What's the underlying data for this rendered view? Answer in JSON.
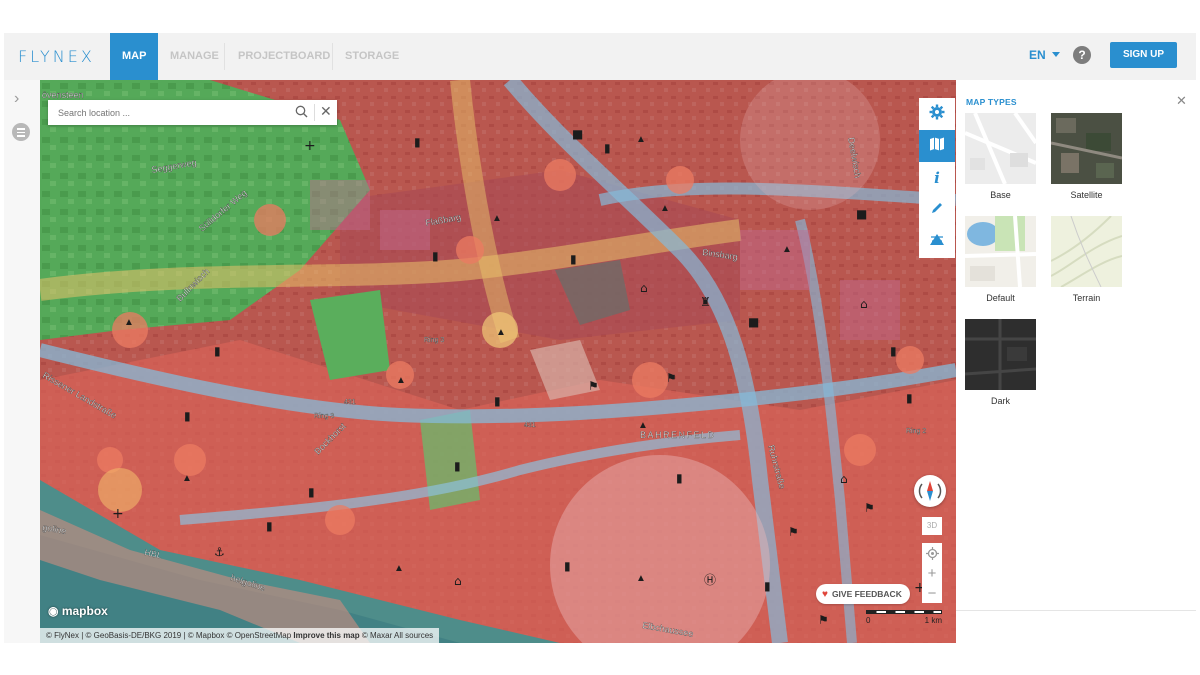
{
  "nav": {
    "logo": "FLYNEX",
    "tabs": [
      {
        "label": "MAP"
      },
      {
        "label": "MANAGE"
      },
      {
        "label": "PROJECTBOARD"
      },
      {
        "label": "STORAGE"
      }
    ],
    "language": "EN",
    "help": "?",
    "signup_label": "SIGN UP"
  },
  "search": {
    "placeholder": "Search location ..."
  },
  "map": {
    "labels": [
      "övensteen",
      "Seggerweg",
      "Sülldorfer Weg",
      "Bullnwisch",
      "Flaßbarg",
      "Binsbarg",
      "Deelwisch",
      "Ring 3",
      "431",
      "Rissener Landstraße",
      "Ring 3",
      "Bockhorst",
      "431",
      "BAHRENFELD",
      "Ruhrstraße",
      "Ring 2",
      "goline",
      "HBL",
      "helgoline",
      "Elbchaussee"
    ],
    "feedback_label": "GIVE FEEDBACK",
    "control_3d": "3D",
    "scale": {
      "start": "0",
      "end": "1 km"
    },
    "logo_text": "mapbox",
    "attribution": {
      "text": "© FlyNex | © GeoBasis-DE/BKG 2019 | © Mapbox © OpenStreetMap",
      "link": "Improve this map",
      "suffix": "© Maxar  All sources"
    },
    "colors": {
      "restricted": "#d9534f",
      "green": "#4caf50",
      "water": "#7db8d4",
      "accent": "#2a8fcf"
    }
  },
  "panel": {
    "title": "MAP TYPES",
    "types": [
      {
        "label": "Base"
      },
      {
        "label": "Satellite"
      },
      {
        "label": "Default"
      },
      {
        "label": "Terrain"
      },
      {
        "label": "Dark"
      }
    ]
  }
}
